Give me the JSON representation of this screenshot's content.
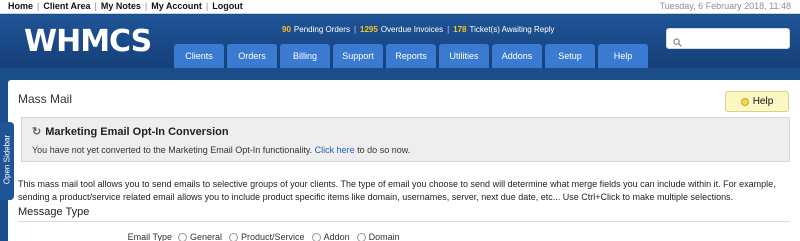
{
  "topbar": {
    "links": [
      "Home",
      "Client Area",
      "My Notes",
      "My Account",
      "Logout"
    ],
    "date": "Tuesday, 6 February 2018, 11:48"
  },
  "header": {
    "logo_text": "WHMCS",
    "stats": [
      {
        "count": "90",
        "label": "Pending Orders"
      },
      {
        "count": "1295",
        "label": "Overdue Invoices"
      },
      {
        "count": "178",
        "label": "Ticket(s) Awaiting Reply"
      }
    ],
    "search": {
      "value": "",
      "placeholder": ""
    },
    "nav": [
      "Clients",
      "Orders",
      "Billing",
      "Support",
      "Reports",
      "Utilities",
      "Addons",
      "Setup",
      "Help"
    ]
  },
  "sidebar": {
    "toggle_label": "Open Sidebar"
  },
  "main": {
    "page_title": "Mass Mail",
    "help_button": "Help",
    "alert": {
      "title": "Marketing Email Opt-In Conversion",
      "text_before": "You have not yet converted to the Marketing Email Opt-In functionality. ",
      "link": "Click here",
      "text_after": " to do so now."
    },
    "description": "This mass mail tool allows you to send emails to selective groups of your clients. The type of email you choose to send will determine what merge fields you can include within it. For example, sending a product/service related email allows you to include product specific items like domain, usernames, server, next due date, etc... Use Ctrl+Click to make multiple selections.",
    "section_title": "Message Type",
    "email_type": {
      "label": "Email Type",
      "options": [
        "General",
        "Product/Service",
        "Addon",
        "Domain"
      ]
    }
  },
  "colors": {
    "header_blue": "#1f5497",
    "nav_tab": "#3b7ad1",
    "stat_number": "#f3c320",
    "link": "#1f5fbf",
    "help_bg": "#fdf7c3"
  }
}
